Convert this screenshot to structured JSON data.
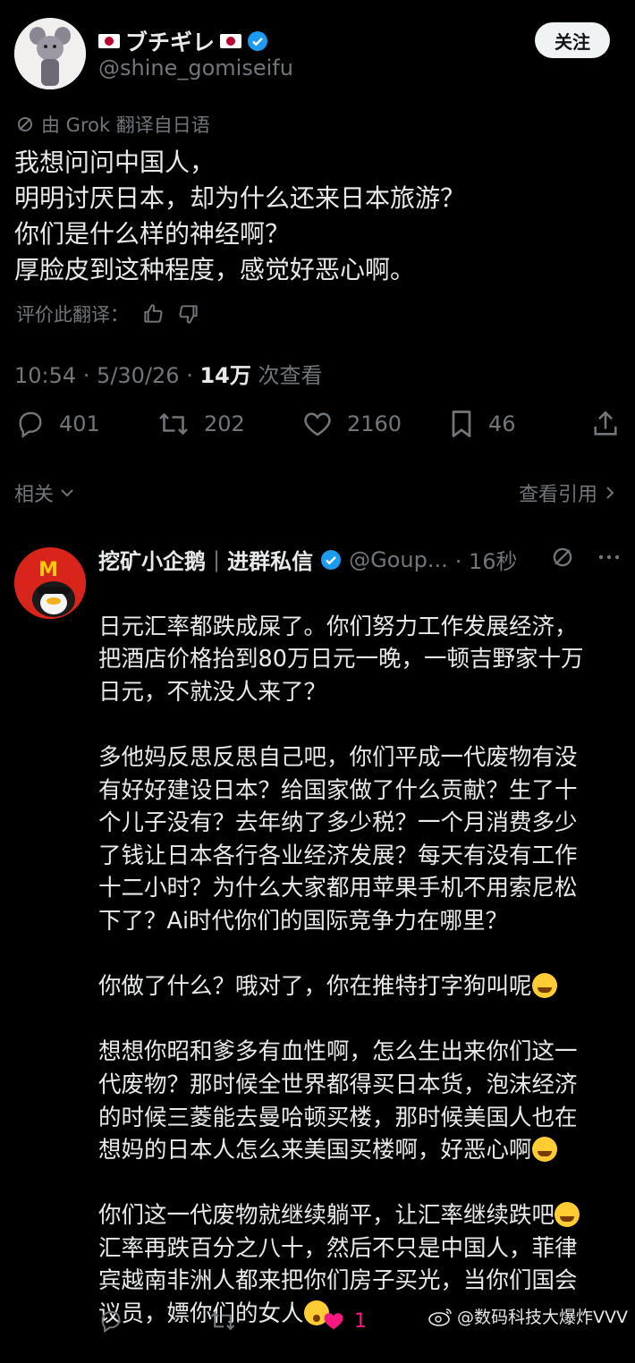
{
  "tweet": {
    "display_name": "ブチギレ",
    "handle": "@shine_gomiseifu",
    "follow_label": "关注",
    "translation_note": "由 Grok 翻译自日语",
    "lines": [
      "我想问问中国人，",
      "明明讨厌日本，却为什么还来日本旅游？",
      "你们是什么样的神经啊？",
      "厚脸皮到这种程度，感觉好恶心啊。"
    ],
    "rate_translation": "评价此翻译：",
    "time": "10:54 · 5/30/26 · ",
    "views_count": "14万",
    "views_label": " 次查看",
    "stats": {
      "replies": "401",
      "retweets": "202",
      "likes": "2160",
      "bookmarks": "46"
    },
    "related_label": "相关",
    "view_quotes_label": "查看引用"
  },
  "reply": {
    "display_name": "挖矿小企鹅",
    "tag": "进群私信",
    "handle": "@Goup...",
    "time": "· 16秒",
    "paragraphs": [
      [
        "日元汇率都跌成屎了。你们努力工作发展经济，",
        "把酒店价格抬到80万日元一晚，一顿吉野家十万",
        "日元，不就没人来了？"
      ],
      [
        "多他妈反思反思自己吧，你们平成一代废物有没",
        "有好好建设日本？给国家做了什么贡献？生了十",
        "个儿子没有？去年纳了多少税？一个月消费多少",
        "了钱让日本各行各业经济发展？每天有没有工作",
        "十二小时？为什么大家都用苹果手机不用索尼松",
        "下了？Ai时代你们的国际竞争力在哪里？"
      ],
      [
        "你做了什么？哦对了，你在推特打字狗叫呢"
      ],
      [
        "想想你昭和爹多有血性啊，怎么生出来你们这一",
        "代废物？那时候全世界都得买日本货，泡沫经济",
        "的时候三菱能去曼哈顿买楼，那时候美国人也在",
        "想妈的日本人怎么来美国买楼啊，好恶心啊"
      ],
      [
        "你们这一代废物就继续躺平，让汇率继续跌吧",
        "汇率再跌百分之八十，然后不只是中国人，菲律",
        "宾越南非洲人都来把你们房子买光，当你们国会",
        "议员，嫖你们的女人"
      ]
    ],
    "like_count": "1"
  },
  "watermark": "@数码科技大爆炸VVV"
}
